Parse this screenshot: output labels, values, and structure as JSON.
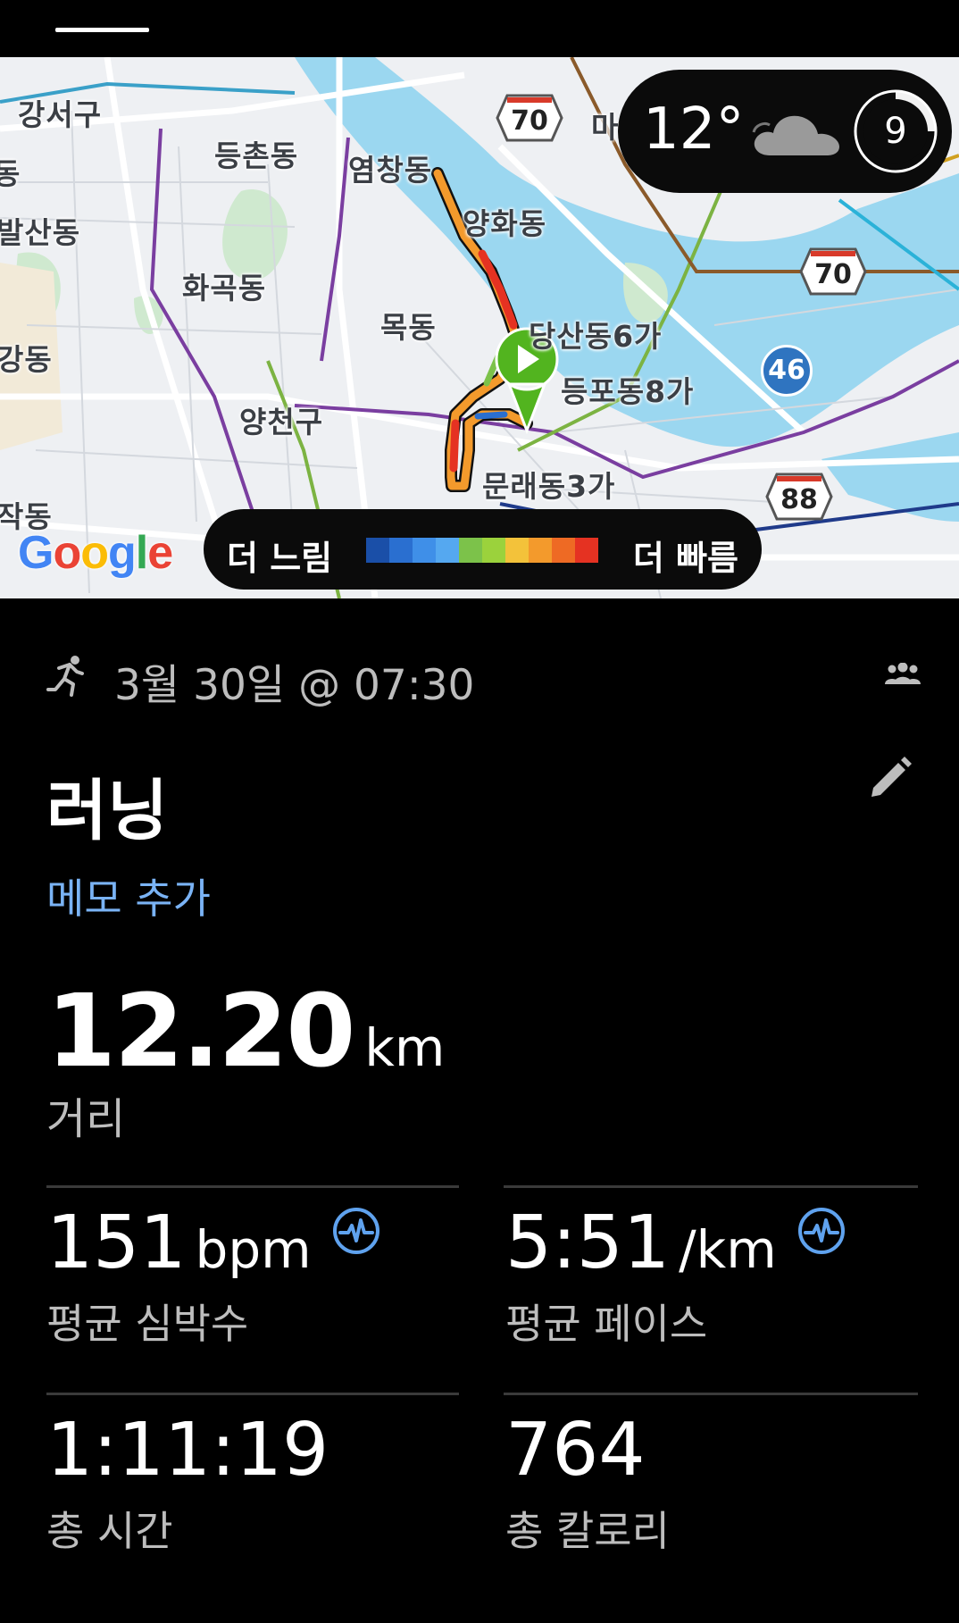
{
  "map": {
    "labels": {
      "gangseo": "강서구",
      "deungchon": "등촌동",
      "yeomchang": "염창동",
      "balsan": "발산동",
      "hwagok": "화곡동",
      "yanghwa": "양화동",
      "mok": "목동",
      "dangsan": "당산동6가",
      "deungpo": "등포동8가",
      "gangdong": "강동",
      "yangcheon": "양천구",
      "munrae": "문래동3가",
      "jak": "작동",
      "ma": "마",
      "dong_edge": "동"
    },
    "route_shields": [
      "70",
      "70",
      "88"
    ],
    "circle_route": "46",
    "google_logo": [
      "G",
      "o",
      "o",
      "g",
      "l",
      "e"
    ],
    "google_colors": [
      "#4285f4",
      "#ea4335",
      "#fbbc05",
      "#4285f4",
      "#34a853",
      "#ea4335"
    ],
    "start_marker_color": "#52b41f"
  },
  "weather": {
    "temperature": "12°",
    "condition_icon": "cloud-icon",
    "ring_value": "9"
  },
  "pace_legend": {
    "slow_label": "더 느림",
    "fast_label": "더 빠름",
    "colors": [
      "#1a4fa8",
      "#2a6fd0",
      "#3f8fe8",
      "#55a8f0",
      "#7cc24a",
      "#9bd23c",
      "#f3c23a",
      "#f39a2c",
      "#ee6a24",
      "#e53222"
    ]
  },
  "activity": {
    "icon": "running-icon",
    "date_time": "3월 30일 @ 07:30",
    "group_icon": "group-icon",
    "title": "러닝",
    "edit_icon": "pencil-icon",
    "memo_link": "메모 추가",
    "distance": {
      "value": "12.20",
      "unit": "km",
      "label": "거리"
    },
    "heart_rate": {
      "value": "151",
      "unit": "bpm",
      "label": "평균 심박수",
      "icon": "pulse-icon"
    },
    "pace": {
      "value": "5:51",
      "unit": "/km",
      "label": "평균 페이스",
      "icon": "pulse-icon"
    },
    "total_time": {
      "value": "1:11:19",
      "label": "총 시간"
    },
    "calories": {
      "value": "764",
      "label": "총 칼로리"
    }
  },
  "colors": {
    "accent_link": "#7ab3f5",
    "river": "#9bd7f0",
    "park": "#cfe9cf"
  }
}
